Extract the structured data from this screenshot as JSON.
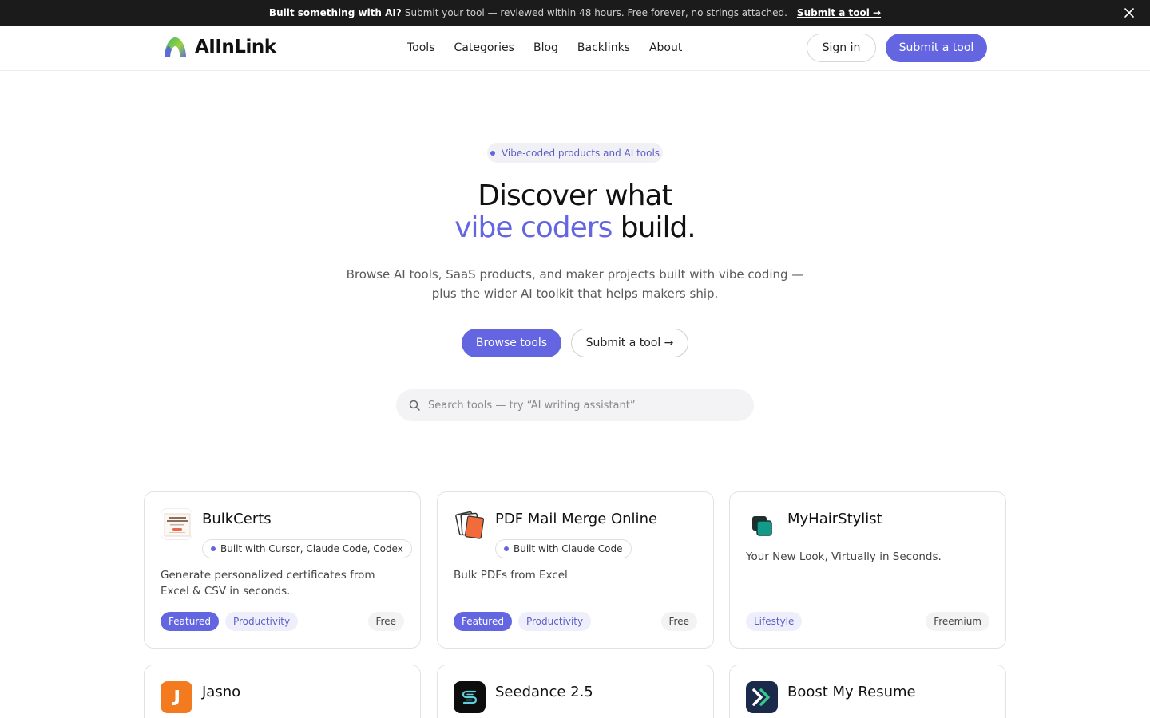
{
  "announcement": {
    "bold": "Built something with AI?",
    "text": "Submit your tool — reviewed within 48 hours. Free forever, no strings attached.",
    "link": "Submit a tool →"
  },
  "header": {
    "logo": "AIInLink",
    "nav": [
      "Tools",
      "Categories",
      "Blog",
      "Backlinks",
      "About"
    ],
    "sign_in": "Sign in",
    "submit": "Submit a tool"
  },
  "hero": {
    "pill": "Vibe-coded products and AI tools",
    "title_line1": "Discover what",
    "title_accent": "vibe coders",
    "title_end": " build.",
    "subtitle": "Browse AI tools, SaaS products, and maker projects built with vibe coding — plus the wider AI toolkit that helps makers ship.",
    "browse_button": "Browse tools",
    "submit_button": "Submit a tool →",
    "search_placeholder": "Search tools — try “AI writing assistant”"
  },
  "colors": {
    "accent": "#6366e0",
    "dark_bar": "#1b1b1b"
  },
  "tools": [
    {
      "name": "BulkCerts",
      "built_with": "Built with Cursor, Claude Code, Codex",
      "description": "Generate personalized certificates from Excel & CSV in seconds.",
      "tags": [
        "Featured",
        "Productivity"
      ],
      "price": "Free",
      "icon": "certificate-icon"
    },
    {
      "name": "PDF Mail Merge Online",
      "built_with": "Built with Claude Code",
      "description": "Bulk PDFs from Excel",
      "tags": [
        "Featured",
        "Productivity"
      ],
      "price": "Free",
      "icon": "pdf-stack-icon"
    },
    {
      "name": "MyHairStylist",
      "built_with": "",
      "description": "Your New Look, Virtually in Seconds.",
      "tags": [
        "Lifestyle"
      ],
      "price": "Freemium",
      "icon": "teal-squares-icon"
    },
    {
      "name": "Jasno",
      "icon": "orange-j-icon"
    },
    {
      "name": "Seedance 2.5",
      "icon": "black-s-icon"
    },
    {
      "name": "Boost My Resume",
      "icon": "navy-chevron-icon"
    }
  ]
}
